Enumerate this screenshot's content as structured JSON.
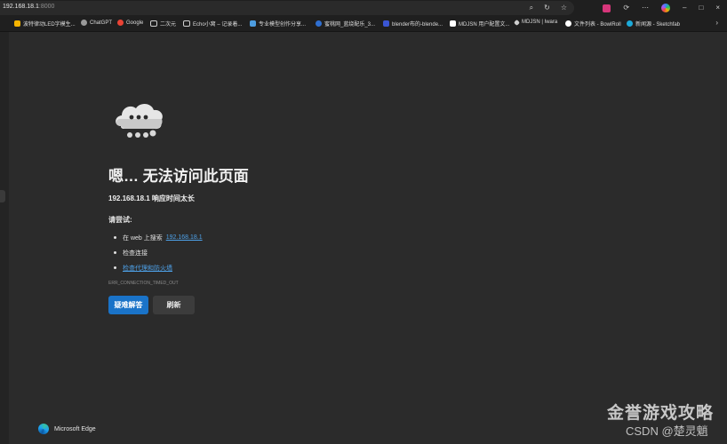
{
  "address_bar": {
    "host": "192.168.18.1",
    "port": ":8000"
  },
  "toolbar_icons": [
    "zoom-icon",
    "reader-icon",
    "favorite-star-icon",
    "extension-icon",
    "refresh-icon",
    "more-icon",
    "copilot-icon"
  ],
  "window_controls": {
    "minimize": "–",
    "maximize": "□",
    "close": "×"
  },
  "bookmarks": [
    {
      "label": "波特律动LED字模生...",
      "color": "#f5b400"
    },
    {
      "label": "ChatGPT",
      "color": "#9a9a9a"
    },
    {
      "label": "Google",
      "color": "#ea4335"
    },
    {
      "label": "二次元",
      "color": "#cfcfcf"
    },
    {
      "label": "Echo小窝 – 记录着...",
      "color": "#cfcfcf"
    },
    {
      "label": "专业模型创作分享...",
      "color": "#4d9de0"
    },
    {
      "label": "蜜桃网_蓝绕配乐_3...",
      "color": "#2f6fd1"
    },
    {
      "label": "blender布的-blende...",
      "color": "#3a56d4"
    },
    {
      "label": "MDJSN 用户配置文...",
      "color": "#ffffff"
    },
    {
      "label": "MDJSN | Iwara",
      "color": "#cfcfcf"
    },
    {
      "label": "文件列表 - BowlRoll",
      "color": "#ffffff"
    },
    {
      "label": "新闻源 - Sketchfab",
      "color": "#1caad9"
    }
  ],
  "error_page": {
    "title": "嗯… 无法访问此页面",
    "subtitle": "192.168.18.1 响应时间太长",
    "try_label": "请尝试:",
    "suggestions": [
      {
        "text": "在 web 上搜索",
        "link": "192.168.18.1"
      },
      {
        "text": "检查连接",
        "link": ""
      },
      {
        "text": "",
        "link": "检查代理和防火墙"
      }
    ],
    "error_code": "ERR_CONNECTION_TIMED_OUT",
    "primary_button": "疑难解答",
    "secondary_button": "刷新"
  },
  "brand": {
    "name": "Microsoft Edge"
  },
  "watermark": {
    "line1": "金誉游戏攻略",
    "line2": "CSDN @楚灵魈"
  }
}
